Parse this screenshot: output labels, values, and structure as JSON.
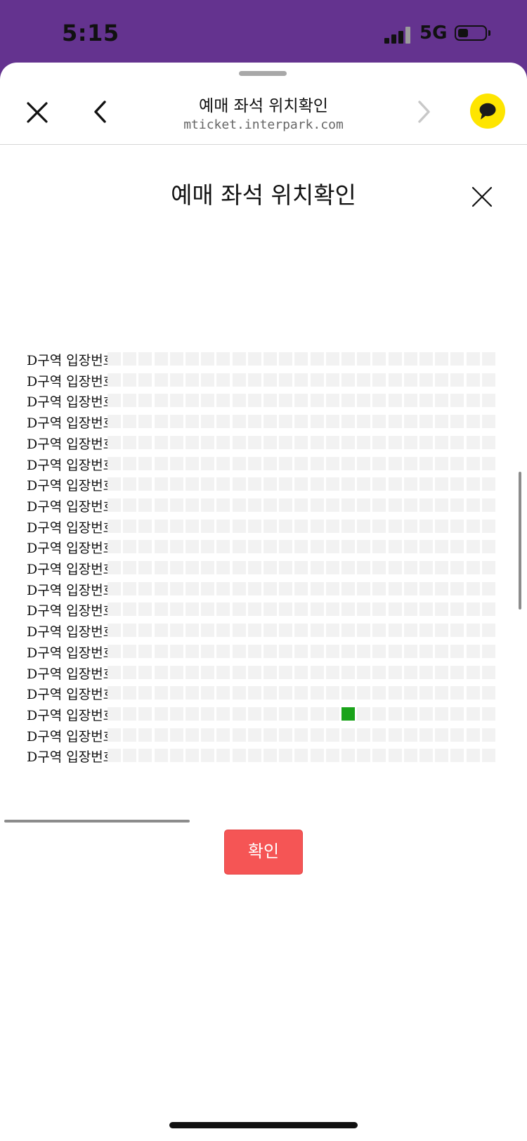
{
  "status_bar": {
    "time": "5:15",
    "network": "5G",
    "signal_bars": 3,
    "battery_level": 0.4
  },
  "browser": {
    "title": "예매 좌석 위치확인",
    "url": "mticket.interpark.com",
    "close_icon": "close-icon",
    "back_icon": "chevron-left-icon",
    "forward_icon": "chevron-right-icon",
    "share_icon": "kakao-chat-icon"
  },
  "page": {
    "title": "예매 좌석 위치확인",
    "close_icon": "close-icon"
  },
  "seat_map": {
    "rows": [
      {
        "label": "D구역 입장번호"
      },
      {
        "label": "D구역 입장번호"
      },
      {
        "label": "D구역 입장번호"
      },
      {
        "label": "D구역 입장번호"
      },
      {
        "label": "D구역 입장번호"
      },
      {
        "label": "D구역 입장번호"
      },
      {
        "label": "D구역 입장번호"
      },
      {
        "label": "D구역 입장번호"
      },
      {
        "label": "D구역 입장번호"
      },
      {
        "label": "D구역 입장번호"
      },
      {
        "label": "D구역 입장번호"
      },
      {
        "label": "D구역 입장번호"
      },
      {
        "label": "D구역 입장번호"
      },
      {
        "label": "D구역 입장번호"
      },
      {
        "label": "D구역 입장번호"
      },
      {
        "label": "D구역 입장번호"
      },
      {
        "label": "D구역 입장번호"
      },
      {
        "label": "D구역 입장번호"
      },
      {
        "label": "D구역 입장번호"
      },
      {
        "label": "D구역 입장번호"
      }
    ],
    "seats_per_row": 25,
    "selected_seat": {
      "row": 17,
      "seat": 15
    },
    "seat_color": "#f2f2f2",
    "selected_color": "#1aa31a"
  },
  "confirm_button": {
    "label": "확인",
    "color": "#f55555"
  },
  "colors": {
    "status_bar_bg": "#64338f",
    "kakao_yellow": "#fee500"
  }
}
